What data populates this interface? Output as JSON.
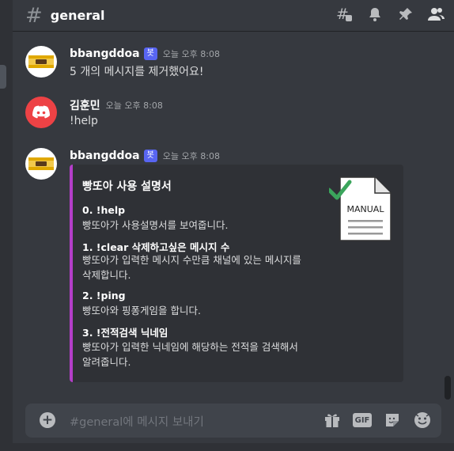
{
  "header": {
    "channel_name": "general",
    "icons": [
      "threads-icon",
      "bell-icon",
      "pin-icon",
      "members-icon"
    ]
  },
  "messages": [
    {
      "author": "bbangddoa",
      "bot_tag": "봇",
      "timestamp": "오늘 오후 8:08",
      "text": "5 개의 메시지를 제거했어요!"
    },
    {
      "author": "김훈민",
      "timestamp": "오늘 오후 8:08",
      "text": "!help"
    },
    {
      "author": "bbangddoa",
      "bot_tag": "봇",
      "timestamp": "오늘 오후 8:08"
    }
  ],
  "embed": {
    "accent_color": "#b43ec9",
    "title": "빵또아 사용 설명서",
    "thumbnail_text": "MANUAL",
    "fields": [
      {
        "name": "0. !help",
        "lines": [
          "빵또아가 사용설명서를 보여줍니다."
        ]
      },
      {
        "name": "1. !clear 삭제하고싶은 메시지 수",
        "lines": [
          "빵또아가 입력한 메시지 수만큼 채널에 있는 메시지를",
          "삭제합니다."
        ]
      },
      {
        "name": "2. !ping",
        "lines": [
          "빵또아와 핑퐁게임을 합니다."
        ]
      },
      {
        "name": "3. !전적검색 닉네임",
        "lines": [
          "빵또아가 입력한 닉네임에 해당하는 전적을 검색해서",
          "알려줍니다."
        ]
      }
    ]
  },
  "input": {
    "placeholder": "#general에 메시지 보내기",
    "gif_label": "GIF",
    "icons": [
      "gift-icon",
      "gif-icon",
      "sticker-icon",
      "emoji-icon"
    ]
  },
  "colors": {
    "background": "#36393f",
    "blurple": "#5865f2",
    "discord_red": "#ed4245"
  }
}
